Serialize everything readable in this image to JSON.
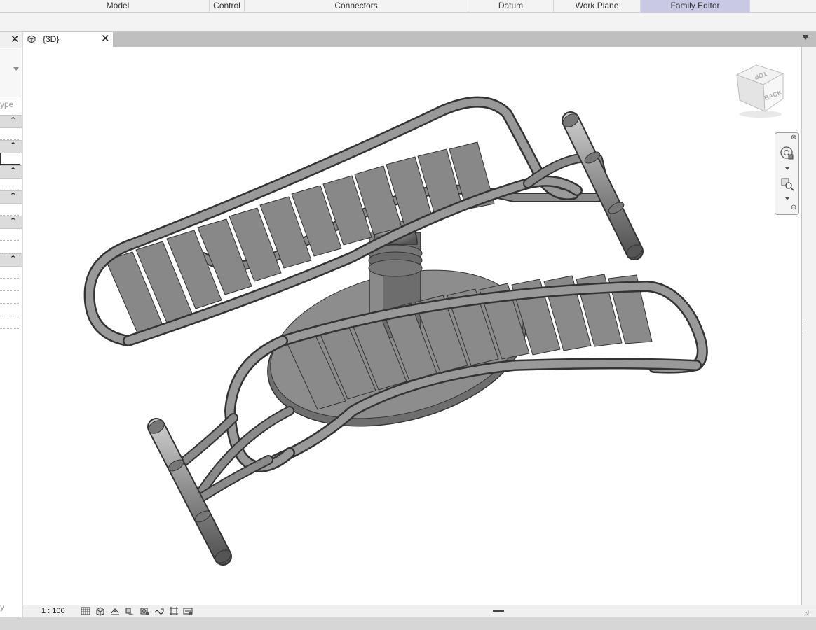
{
  "ribbon": {
    "groups": [
      {
        "label": "Model",
        "active": false
      },
      {
        "label": "Control",
        "active": false
      },
      {
        "label": "Connectors",
        "active": false
      },
      {
        "label": "Datum",
        "active": false
      },
      {
        "label": "Work Plane",
        "active": false
      },
      {
        "label": "Family Editor",
        "active": true
      }
    ]
  },
  "properties": {
    "edit_type_label": "ype",
    "footer_label": "y"
  },
  "view_tab": {
    "label": "{3D}"
  },
  "viewcube": {
    "top_face": "TOP",
    "front_face": "BACK"
  },
  "view_control_bar": {
    "scale": "1 : 100",
    "icons": [
      "detail-level-icon",
      "visual-style-icon",
      "sun-path-icon",
      "shadows-icon",
      "rendering-icon",
      "crop-view-icon",
      "show-crop-icon",
      "temporary-hide-icon"
    ]
  },
  "colors": {
    "active_group": "#c9c9e6",
    "model_fill": "#8a8a8a",
    "canvas_bg": "#ffffff"
  }
}
